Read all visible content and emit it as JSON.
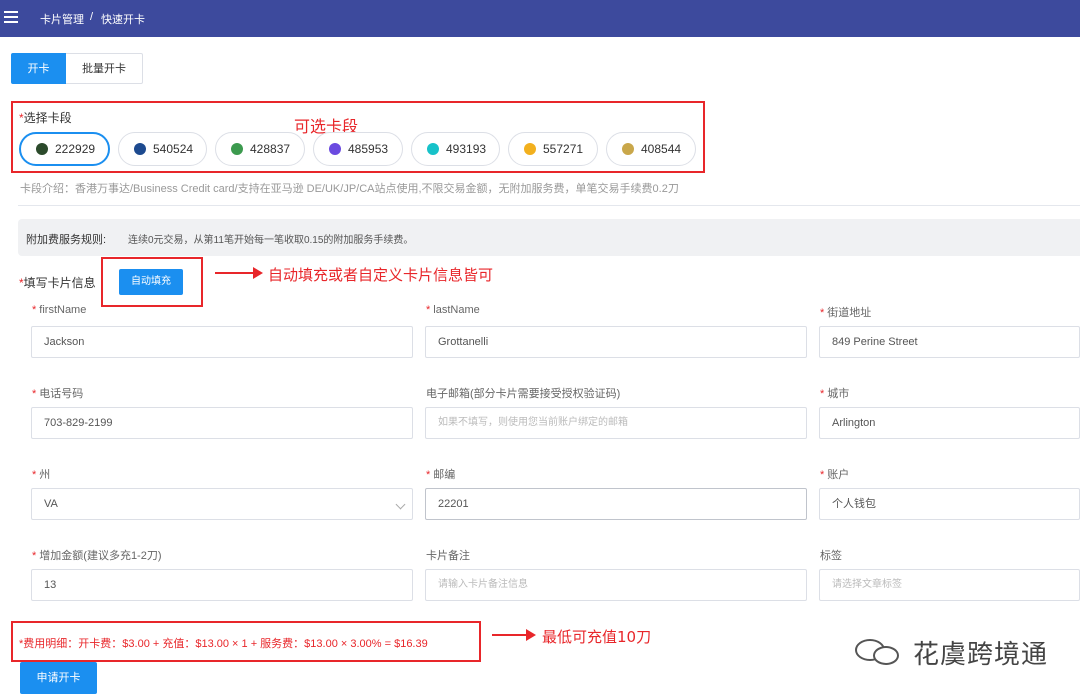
{
  "breadcrumb": {
    "parent": "卡片管理",
    "separator": "/",
    "current": "快速开卡"
  },
  "tabs": [
    {
      "label": "开卡",
      "active": true
    },
    {
      "label": "批量开卡",
      "active": false
    }
  ],
  "card_segment": {
    "label": "选择卡段",
    "required_mark": "*",
    "options": [
      {
        "code": "222929",
        "selected": true,
        "logo_color": "#2b4a2b"
      },
      {
        "code": "540524",
        "selected": false,
        "logo_color": "#1d4a8f"
      },
      {
        "code": "428837",
        "selected": false,
        "logo_color": "#3c9a4e"
      },
      {
        "code": "485953",
        "selected": false,
        "logo_color": "#6b4ae0"
      },
      {
        "code": "493193",
        "selected": false,
        "logo_color": "#17c2c9"
      },
      {
        "code": "557271",
        "selected": false,
        "logo_color": "#f2b01e"
      },
      {
        "code": "408544",
        "selected": false,
        "logo_color": "#c9a74a"
      }
    ],
    "intro": "卡段介绍：香港万事达/Business Credit card/支持在亚马逊 DE/UK/JP/CA站点使用,不限交易金额，无附加服务费，单笔交易手续费0.2刀"
  },
  "fee_rules": {
    "label": "附加费服务规则:",
    "text": "连续0元交易，从第11笔开始每一笔收取0.15的附加服务手续费。"
  },
  "card_info": {
    "label": "填写卡片信息",
    "required_mark": "*",
    "autofill_label": "自动填充"
  },
  "fields": {
    "first_name": {
      "label": "firstName",
      "required": true,
      "value": "Jackson",
      "placeholder": ""
    },
    "last_name": {
      "label": "lastName",
      "required": true,
      "value": "Grottanelli",
      "placeholder": ""
    },
    "street": {
      "label": "街道地址",
      "required": true,
      "value": "849  Perine Street",
      "placeholder": ""
    },
    "phone": {
      "label": "电话号码",
      "required": true,
      "value": "703-829-2199",
      "placeholder": ""
    },
    "email": {
      "label": "电子邮箱(部分卡片需要接受授权验证码)",
      "required": false,
      "value": "",
      "placeholder": "如果不填写，则使用您当前账户绑定的邮箱"
    },
    "city": {
      "label": "城市",
      "required": true,
      "value": "Arlington",
      "placeholder": ""
    },
    "state": {
      "label": "州",
      "required": true,
      "value": "VA",
      "placeholder": ""
    },
    "zip": {
      "label": "邮编",
      "required": true,
      "value": "22201",
      "placeholder": ""
    },
    "account": {
      "label": "账户",
      "required": true,
      "value": "个人钱包",
      "placeholder": ""
    },
    "amount": {
      "label": "增加金额(建议多充1-2刀)",
      "required": true,
      "value": "13",
      "placeholder": ""
    },
    "note": {
      "label": "卡片备注",
      "required": false,
      "value": "",
      "placeholder": "请输入卡片备注信息"
    },
    "tag": {
      "label": "标签",
      "required": false,
      "value": "",
      "placeholder": "请选择文章标签"
    }
  },
  "fee_detail": "*费用明细：开卡费：$3.00 + 充值：$13.00 × 1 + 服务费：$13.00 × 3.00% = $16.39",
  "submit_label": "申请开卡",
  "annotations": {
    "card_segment": "可选卡段",
    "autofill": "自动填充或者自定义卡片信息皆可",
    "min_topup": "最低可充值10刀"
  },
  "watermark": "花虞跨境通",
  "colors": {
    "header": "#3d4a9d",
    "primary": "#1b8ff0",
    "annotation": "#e8262a"
  }
}
